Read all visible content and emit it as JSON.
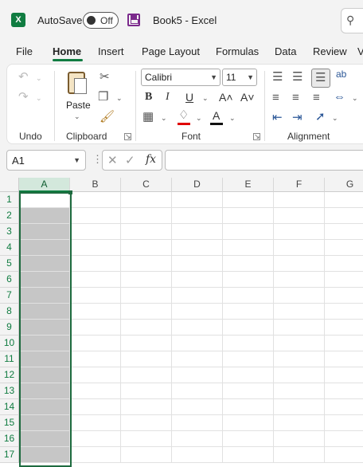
{
  "titlebar": {
    "logo": "X",
    "autosave_label": "AutoSave",
    "autosave_state": "Off",
    "doc_title": "Book5  -  Excel"
  },
  "tabs": [
    "File",
    "Home",
    "Insert",
    "Page Layout",
    "Formulas",
    "Data",
    "Review",
    "V"
  ],
  "active_tab": "Home",
  "ribbon": {
    "groups": {
      "undo": "Undo",
      "clipboard": "Clipboard",
      "font": "Font",
      "alignment": "Alignment"
    },
    "paste_label": "Paste",
    "font_name": "Calibri",
    "font_size": "11",
    "bold": "B",
    "italic": "I",
    "underline": "U",
    "grow_font": "A˄",
    "shrink_font": "A˅",
    "font_color_glyph": "A",
    "wrap_glyph": "ab"
  },
  "formula_bar": {
    "name_box": "A1",
    "fx": "fx",
    "cancel_glyph": "✕",
    "enter_glyph": "✓",
    "content": ""
  },
  "sheet": {
    "columns": [
      "A",
      "B",
      "C",
      "D",
      "E",
      "F",
      "G"
    ],
    "rows": [
      "1",
      "2",
      "3",
      "4",
      "5",
      "6",
      "7",
      "8",
      "9",
      "10",
      "11",
      "12",
      "13",
      "14",
      "15",
      "16",
      "17"
    ],
    "selected_column": "A",
    "active_cell": "A1"
  },
  "colors": {
    "accent": "#107c41",
    "selection_fill": "#c6c6c6"
  }
}
